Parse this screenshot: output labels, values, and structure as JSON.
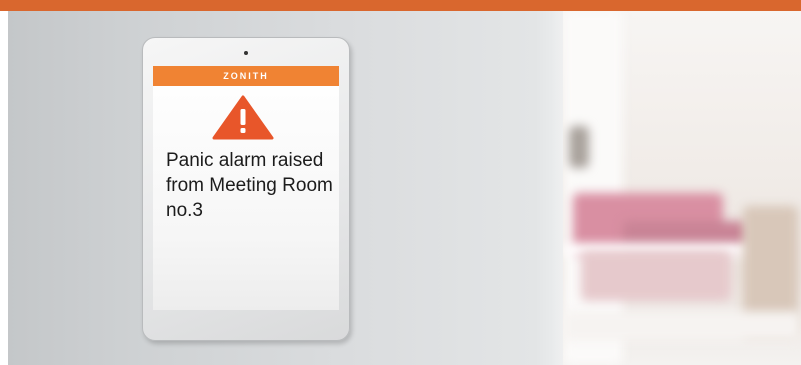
{
  "brand": {
    "name": "ZONITH",
    "color": "#f08333"
  },
  "alert": {
    "icon": "warning-icon",
    "lines": [
      "Panic alarm raised",
      "from Meeting Room",
      "no.3"
    ]
  },
  "colors": {
    "top_bar": "#d9672e",
    "warning": "#e8562a"
  }
}
